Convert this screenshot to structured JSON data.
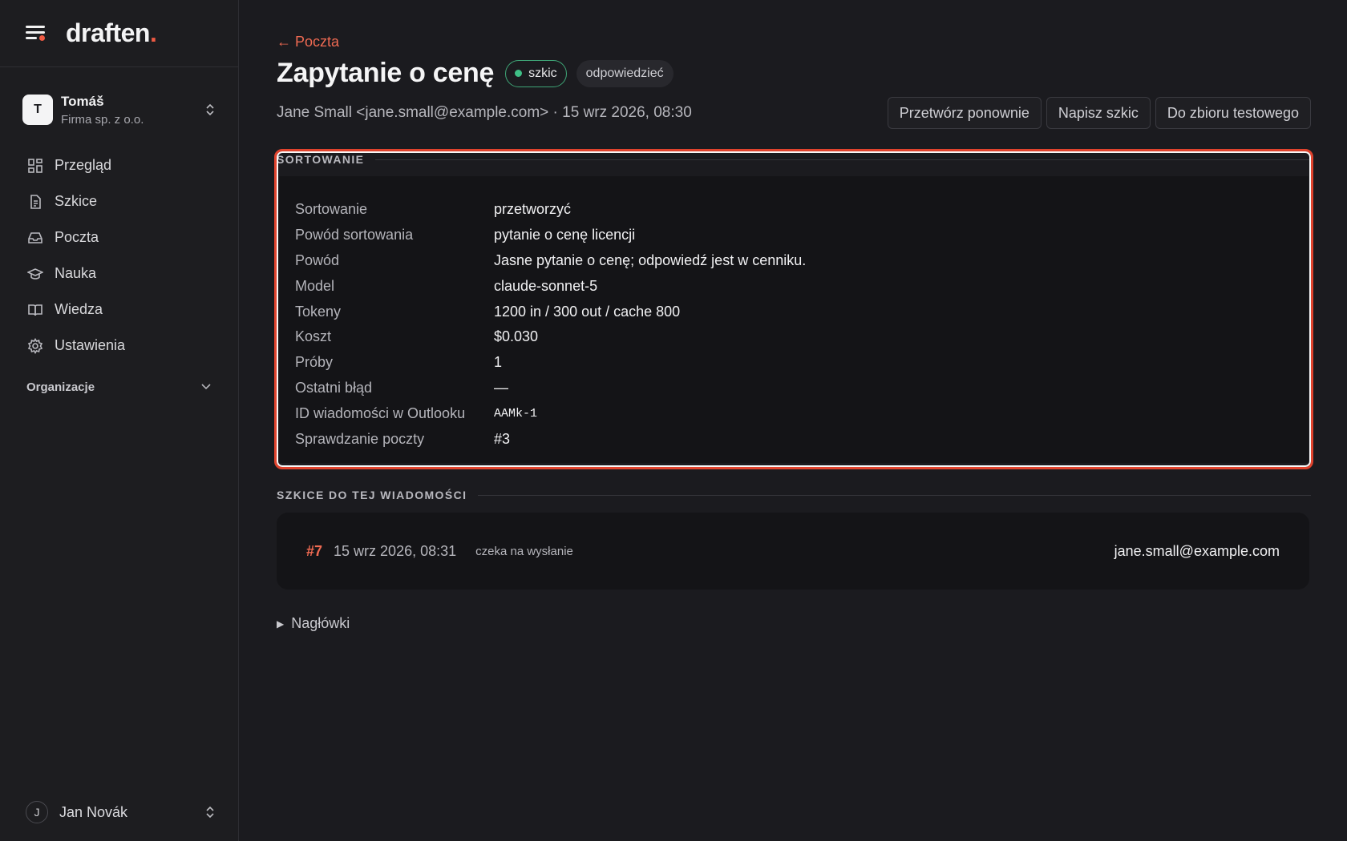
{
  "app": {
    "brand": "draften",
    "brand_dot": "."
  },
  "org": {
    "initial": "T",
    "name": "Tomáš",
    "company": "Firma sp. z o.o."
  },
  "nav": [
    {
      "label": "Przegląd",
      "icon": "grid-icon"
    },
    {
      "label": "Szkice",
      "icon": "document-icon"
    },
    {
      "label": "Poczta",
      "icon": "inbox-icon"
    },
    {
      "label": "Nauka",
      "icon": "graduation-cap-icon"
    },
    {
      "label": "Wiedza",
      "icon": "book-icon"
    },
    {
      "label": "Ustawienia",
      "icon": "gear-icon"
    }
  ],
  "section_label": "Organizacje",
  "user": {
    "initial": "J",
    "name": "Jan Novák"
  },
  "page": {
    "back": "← Poczta",
    "title": "Zapytanie o cenę",
    "badge_status": "szkic",
    "badge_type": "odpowiedzieć",
    "meta": "Jane Small <jane.small@example.com> · 15 wrz 2026, 08:30",
    "actions": [
      "Przetwórz ponownie",
      "Napisz szkic",
      "Do zbioru testowego"
    ]
  },
  "sorting": {
    "heading": "SORTOWANIE",
    "rows": [
      {
        "key": "Sortowanie",
        "value": "przetworzyć"
      },
      {
        "key": "Powód sortowania",
        "value": "pytanie o cenę licencji"
      },
      {
        "key": "Powód",
        "value": "Jasne pytanie o cenę; odpowiedź jest w cenniku."
      },
      {
        "key": "Model",
        "value": "claude-sonnet-5"
      },
      {
        "key": "Tokeny",
        "value": "1200 in / 300 out / cache 800"
      },
      {
        "key": "Koszt",
        "value": "$0.030"
      },
      {
        "key": "Próby",
        "value": "1"
      },
      {
        "key": "Ostatni błąd",
        "value": "—"
      },
      {
        "key": "ID wiadomości w Outlooku",
        "value": "AAMk-1"
      },
      {
        "key": "Sprawdzanie poczty",
        "value": "#3"
      }
    ]
  },
  "drafts": {
    "heading": "SZKICE DO TEJ WIADOMOŚCI",
    "items": [
      {
        "num": "#7",
        "date": "15 wrz 2026, 08:31",
        "status": "czeka na wysłanie",
        "email": "jane.small@example.com"
      }
    ]
  },
  "headers_toggle": "Nagłówki",
  "colors": {
    "accent": "#ef5a43",
    "status_green": "#3fbf86",
    "highlight": "#e0432d"
  }
}
